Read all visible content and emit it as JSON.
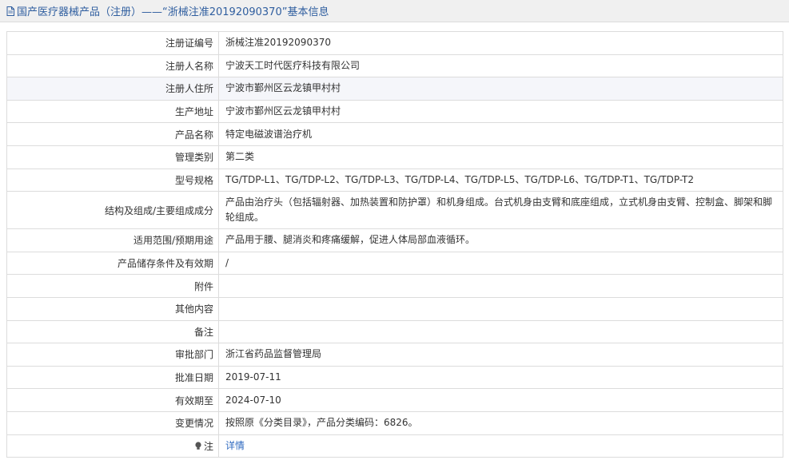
{
  "header": {
    "title": "国产医疗器械产品（注册）——“浙械注准20192090370”基本信息"
  },
  "rows": [
    {
      "label": "注册证编号",
      "value": "浙械注准20192090370"
    },
    {
      "label": "注册人名称",
      "value": "宁波天工时代医疗科技有限公司"
    },
    {
      "label": "注册人住所",
      "value": "宁波市鄞州区云龙镇甲村村"
    },
    {
      "label": "生产地址",
      "value": "宁波市鄞州区云龙镇甲村村"
    },
    {
      "label": "产品名称",
      "value": "特定电磁波谱治疗机"
    },
    {
      "label": "管理类别",
      "value": "第二类"
    },
    {
      "label": "型号规格",
      "value": "TG/TDP-L1、TG/TDP-L2、TG/TDP-L3、TG/TDP-L4、TG/TDP-L5、TG/TDP-L6、TG/TDP-T1、TG/TDP-T2"
    },
    {
      "label": "结构及组成/主要组成成分",
      "value": "产品由治疗头（包括辐射器、加热装置和防护罩）和机身组成。台式机身由支臂和底座组成，立式机身由支臂、控制盒、脚架和脚轮组成。"
    },
    {
      "label": "适用范围/预期用途",
      "value": "产品用于腰、腿消炎和疼痛缓解，促进人体局部血液循环。"
    },
    {
      "label": "产品储存条件及有效期",
      "value": "/"
    },
    {
      "label": "附件",
      "value": ""
    },
    {
      "label": "其他内容",
      "value": ""
    },
    {
      "label": "备注",
      "value": ""
    },
    {
      "label": "审批部门",
      "value": "浙江省药品监督管理局"
    },
    {
      "label": "批准日期",
      "value": "2019-07-11"
    },
    {
      "label": "有效期至",
      "value": "2024-07-10"
    },
    {
      "label": "变更情况",
      "value": "按照原《分类目录》，产品分类编码：6826。"
    },
    {
      "label": "注",
      "value": "详情"
    }
  ],
  "colors": {
    "title_text": "#2f5e9f",
    "link": "#2f6ac0",
    "border": "#dcdcdc",
    "alt_row": "#f5f6fa"
  },
  "icons": {
    "header": "document-icon",
    "note": "lightbulb-icon"
  }
}
